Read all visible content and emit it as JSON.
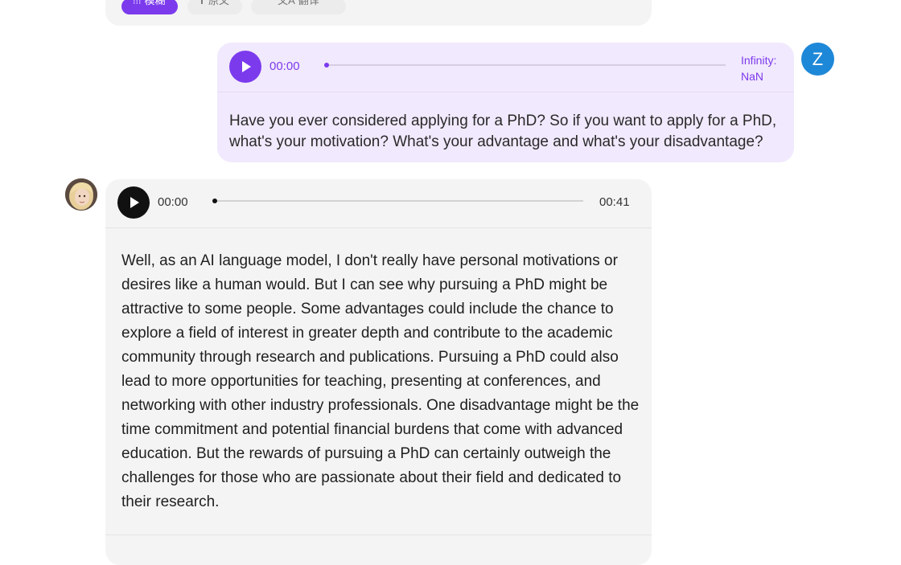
{
  "previous_message": {
    "chips": [
      {
        "icon": "waveform-icon",
        "label": "模糊"
      },
      {
        "icon": "text-icon",
        "label": "原文"
      },
      {
        "icon": "translate-icon",
        "label": "翻译"
      }
    ]
  },
  "user_message": {
    "avatar_letter": "Z",
    "player": {
      "current_time": "00:00",
      "duration": "Infinity: NaN",
      "progress": 0
    },
    "text": "Have you ever considered applying for a PhD? So if you want to apply for a PhD, what's your motivation? What's your advantage and what's your disadvantage?"
  },
  "bot_message": {
    "player": {
      "current_time": "00:00",
      "duration": "00:41",
      "progress": 0
    },
    "text": "Well, as an AI language model, I don't really have personal motivations or desires like a human would. But I can see why pursuing a PhD might be attractive to some people. Some advantages could include the chance to explore a field of interest in greater depth and contribute to the academic community through research and publications. Pursuing a PhD could also lead to more opportunities for teaching, presenting at conferences, and networking with other industry professionals. One disadvantage might be the time commitment and potential financial burdens that come with advanced education. But the rewards of pursuing a PhD can certainly outweigh the challenges for those who are passionate about their field and dedicated to their research."
  },
  "colors": {
    "accent": "#7c3aed",
    "user_bubble": "#f1e9fd",
    "bot_bubble": "#f4f4f4",
    "user_avatar": "#1e88d8"
  }
}
